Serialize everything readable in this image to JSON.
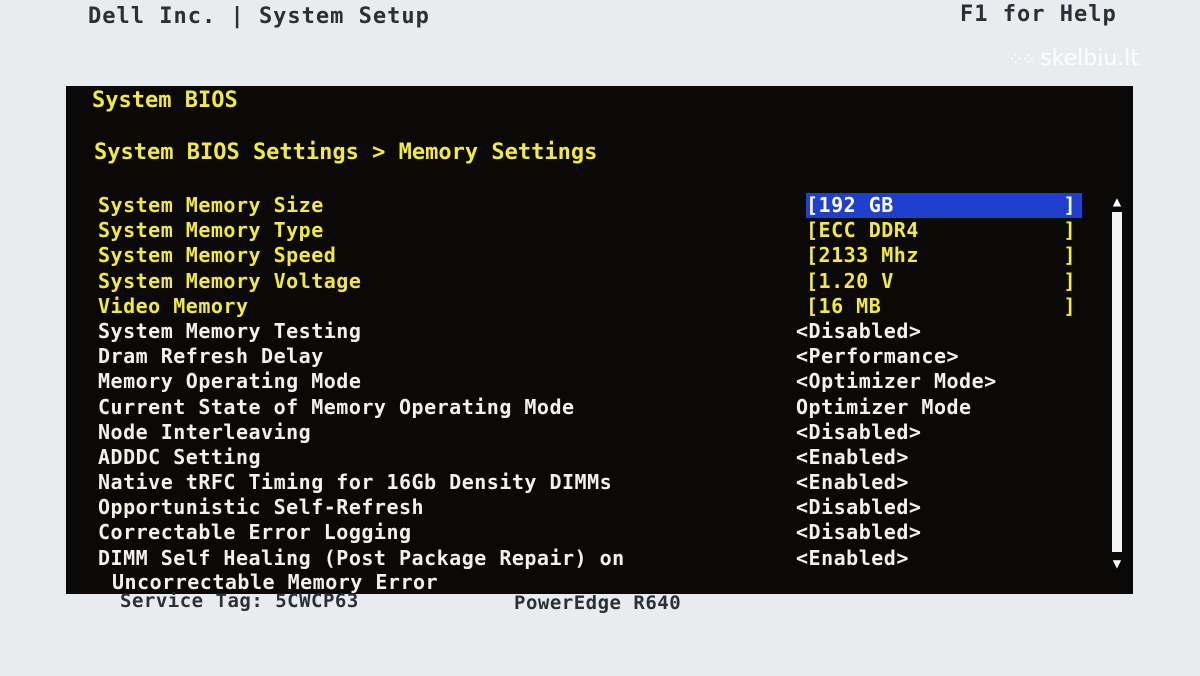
{
  "header": {
    "vendor_title": "Dell Inc. | System Setup",
    "help": "F1 for Help"
  },
  "watermark": {
    "text": "skelbiu.lt",
    "icon": "dots-grid-icon"
  },
  "panel": {
    "title": "System BIOS",
    "breadcrumb": "System BIOS Settings > Memory Settings"
  },
  "settings": [
    {
      "label": "System Memory Size",
      "value": "[192 GB",
      "close": "]",
      "editable": false,
      "selected": true
    },
    {
      "label": "System Memory Type",
      "value": "[ECC DDR4",
      "close": "]",
      "editable": false
    },
    {
      "label": "System Memory Speed",
      "value": "[2133 Mhz",
      "close": "]",
      "editable": false
    },
    {
      "label": "System Memory Voltage",
      "value": "[1.20 V",
      "close": "]",
      "editable": false
    },
    {
      "label": "Video Memory",
      "value": "[16 MB",
      "close": "]",
      "editable": false
    },
    {
      "label": "System Memory Testing",
      "value": "<Disabled>",
      "editable": true
    },
    {
      "label": "Dram Refresh Delay",
      "value": "<Performance>",
      "editable": true
    },
    {
      "label": "Memory Operating Mode",
      "value": "<Optimizer Mode>",
      "editable": true
    },
    {
      "label": "Current State of Memory Operating Mode",
      "value": "Optimizer Mode",
      "editable": false
    },
    {
      "label": "Node Interleaving",
      "value": "<Disabled>",
      "editable": true
    },
    {
      "label": "ADDDC Setting",
      "value": "<Enabled>",
      "editable": true
    },
    {
      "label": "Native tRFC Timing for 16Gb Density DIMMs",
      "value": "<Enabled>",
      "editable": true
    },
    {
      "label": "Opportunistic Self-Refresh",
      "value": "<Disabled>",
      "editable": true
    },
    {
      "label": "Correctable Error Logging",
      "value": "<Disabled>",
      "editable": true
    },
    {
      "label": "DIMM Self Healing (Post Package Repair) on",
      "label_line2": "Uncorrectable Memory Error",
      "value": "<Enabled>",
      "editable": true
    }
  ],
  "scrollbar": {
    "up_icon": "scroll-up-arrow-icon",
    "down_icon": "scroll-down-arrow-icon"
  },
  "footer": {
    "service_tag": "Service Tag: 5CWCP63",
    "model": "PowerEdge R640"
  },
  "colors": {
    "panel_bg": "#0b0908",
    "readonly_text": "#f2ea3c",
    "editable_text": "#f3f1ea",
    "selection_bg": "#1f3fcc",
    "screen_bg": "#e9ecef"
  }
}
